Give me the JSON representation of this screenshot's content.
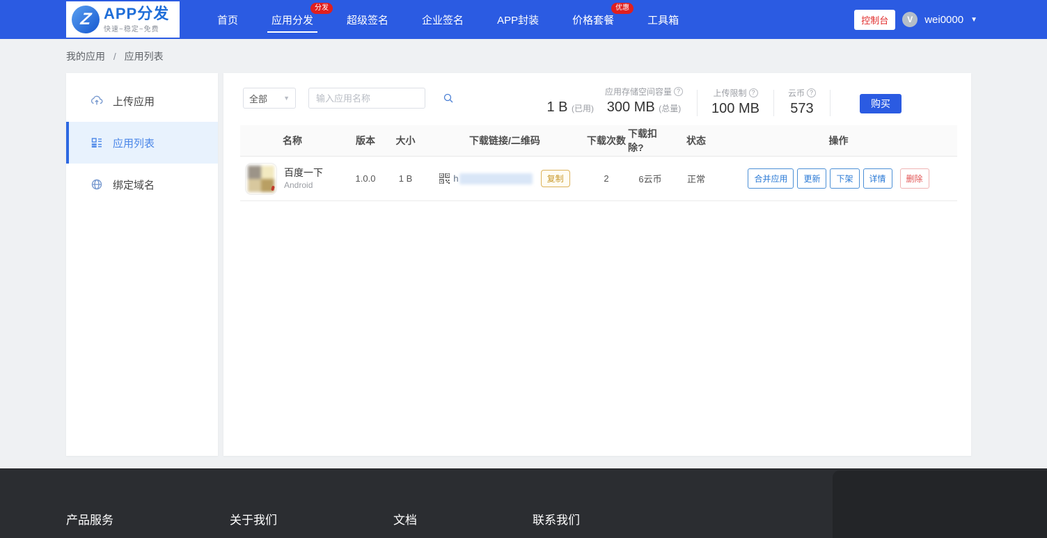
{
  "colors": {
    "navbar_blue": "#2b5be2",
    "badge_red": "#e01f1f",
    "action_blue": "#2b7ad6",
    "danger_red": "#e25555",
    "copy_gold": "#c9992e",
    "sidebar_active_bg": "#e8f2fd",
    "footer_bg": "#2b2d31"
  },
  "navbar": {
    "logo": {
      "title": "APP分发",
      "tagline": "快速~稳定~免费"
    },
    "items": [
      {
        "label": "首页"
      },
      {
        "label": "应用分发",
        "badge": "分发"
      },
      {
        "label": "超级签名"
      },
      {
        "label": "企业签名"
      },
      {
        "label": "APP封装"
      },
      {
        "label": "价格套餐",
        "badge": "优惠"
      },
      {
        "label": "工具箱"
      }
    ],
    "console_button": "控制台",
    "user": {
      "name": "wei0000",
      "avatar_letter": "V"
    }
  },
  "breadcrumb": {
    "items": [
      "我的应用",
      "应用列表"
    ],
    "separator": "/"
  },
  "sidebar": {
    "items": [
      {
        "label": "上传应用",
        "icon": "cloud-upload-icon"
      },
      {
        "label": "应用列表",
        "icon": "app-list-icon"
      },
      {
        "label": "绑定域名",
        "icon": "globe-icon"
      }
    ]
  },
  "toolbar": {
    "filter": {
      "value": "全部"
    },
    "search": {
      "placeholder": "输入应用名称"
    },
    "stats": {
      "storage": {
        "used_value": "1 B",
        "used_label": "(已用)",
        "capacity_label": "应用存储空间容量",
        "total_value": "300 MB",
        "total_label": "(总量)"
      },
      "upload_limit": {
        "label": "上传限制",
        "value": "100 MB"
      },
      "cloud_coin": {
        "label": "云币",
        "value": "573"
      }
    },
    "buy_button": "购买"
  },
  "table": {
    "headers": [
      "名称",
      "版本",
      "大小",
      "下载链接/二维码",
      "下载次数",
      "下载扣除?",
      "状态",
      "操作"
    ],
    "rows": [
      {
        "name": "百度一下",
        "platform": "Android",
        "version": "1.0.0",
        "size": "1 B",
        "link_prefix": "h",
        "copy_button": "复制",
        "downloads": "2",
        "deduction": "6云币",
        "status": "正常",
        "actions": [
          {
            "label": "合并应用",
            "type": "blue"
          },
          {
            "label": "更新",
            "type": "blue"
          },
          {
            "label": "下架",
            "type": "blue"
          },
          {
            "label": "详情",
            "type": "blue"
          },
          {
            "label": "删除",
            "type": "danger"
          }
        ]
      }
    ]
  },
  "footer": {
    "columns": [
      "产品服务",
      "关于我们",
      "文档",
      "联系我们"
    ]
  }
}
